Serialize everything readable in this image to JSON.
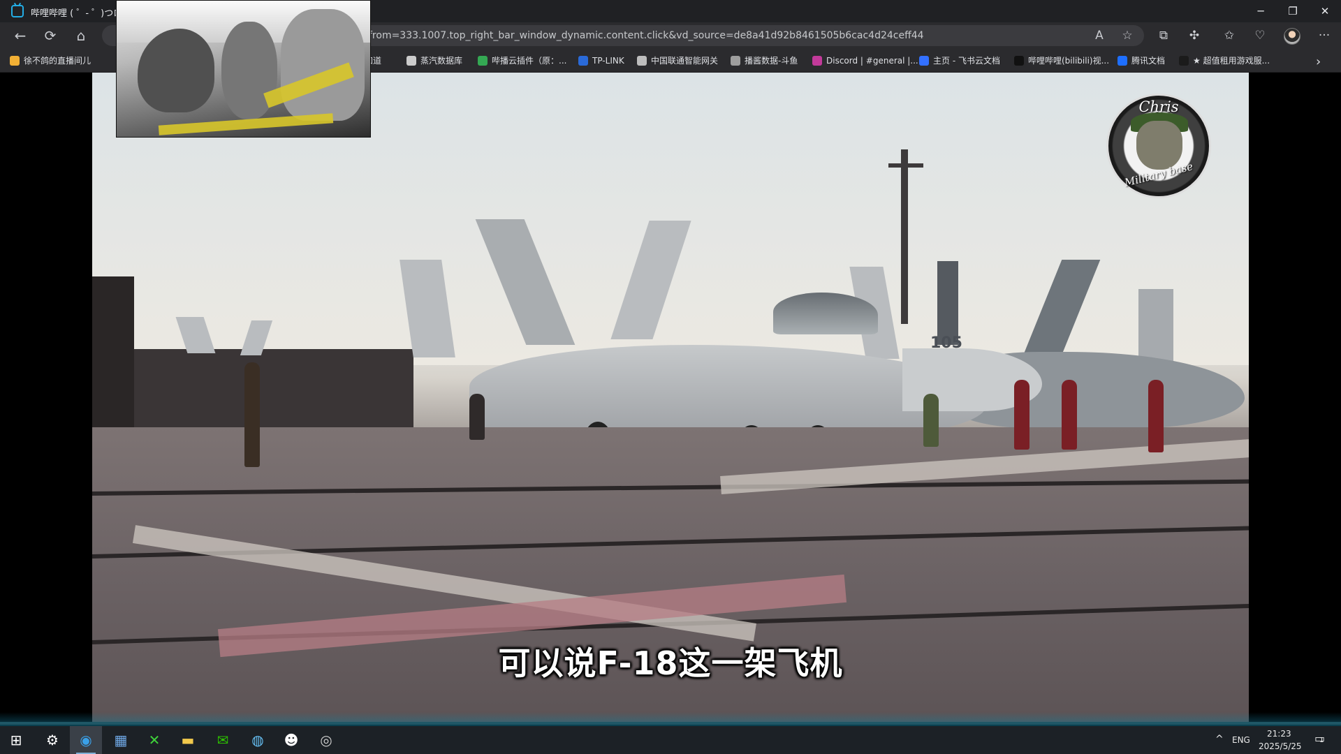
{
  "browser": {
    "tab_title": "哔哩哔哩 ( ゜- ゜)つロ 干",
    "address_url": "from=333.1007.top_right_bar_window_dynamic.content.click&vd_source=de8a41d92b8461505b6cac4d24ceff44",
    "window_controls": {
      "minimize": "─",
      "restore": "❐",
      "close": "✕"
    },
    "nav_icons": {
      "back": "←",
      "refresh": "⟳",
      "home": "⌂"
    },
    "address_icons": {
      "read_aloud": "A",
      "favorite": "☆"
    },
    "toolbar_icons": {
      "split": "⧉",
      "extensions": "✣",
      "favorites": "✩",
      "performance": "♡",
      "menu": "···"
    }
  },
  "bookmarks": [
    {
      "label": "徐不鸽的直播间儿",
      "icon_color": "#f2b035"
    },
    {
      "label": "就知道",
      "icon_color": "#3c3c3c"
    },
    {
      "label": "蒸汽数据库",
      "icon_color": "#cccccc"
    },
    {
      "label": "哔播云插件（原：...",
      "icon_color": "#34a853"
    },
    {
      "label": "TP-LINK",
      "icon_color": "#2a6ad8"
    },
    {
      "label": "中国联通智能网关",
      "icon_color": "#bdbdbd"
    },
    {
      "label": "播酱数据-斗鱼",
      "icon_color": "#9e9e9e"
    },
    {
      "label": "Discord | #general |...",
      "icon_color": "#c23a9a"
    },
    {
      "label": "主页 - 飞书云文档",
      "icon_color": "#3370ff"
    },
    {
      "label": "哔哩哔哩(bilibili)视...",
      "icon_color": "#111111"
    },
    {
      "label": "腾讯文档",
      "icon_color": "#1e6fff"
    },
    {
      "label": "★ 超值租用游戏服...",
      "icon_color": "#1b1b1b"
    }
  ],
  "bookmarks_more": "›",
  "video": {
    "subtitle": "可以说F-18这一架飞机",
    "watermark_line1": "Chris",
    "watermark_line2": "Military base",
    "jet_number": "105"
  },
  "taskbar": {
    "apps": [
      {
        "name": "start",
        "glyph": "⊞"
      },
      {
        "name": "settings",
        "glyph": "⚙"
      },
      {
        "name": "edge",
        "glyph": "◉"
      },
      {
        "name": "calculator",
        "glyph": "▦"
      },
      {
        "name": "xbox",
        "glyph": "✕"
      },
      {
        "name": "file-explorer",
        "glyph": "▬"
      },
      {
        "name": "wechat",
        "glyph": "✉"
      },
      {
        "name": "steam",
        "glyph": "◍"
      },
      {
        "name": "qq",
        "glyph": "☻"
      },
      {
        "name": "obs",
        "glyph": "◎"
      }
    ],
    "tray_chevron": "^",
    "language": "ENG",
    "time": "21:23",
    "date": "2025/5/25",
    "notification_count": "1"
  },
  "colors": {
    "browser_bg": "#202124",
    "accent_progress": "#1f5766",
    "subtitle": "#ffffff"
  }
}
